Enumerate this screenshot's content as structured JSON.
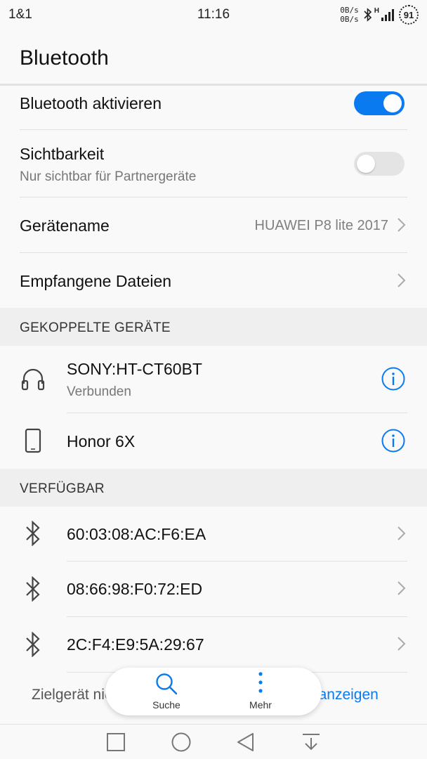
{
  "status_bar": {
    "carrier": "1&1",
    "time": "11:16",
    "net_up": "0B/s",
    "net_down": "0B/s",
    "network_type": "H",
    "battery": "91"
  },
  "header": {
    "title": "Bluetooth"
  },
  "settings": {
    "bluetooth_toggle": {
      "label": "Bluetooth aktivieren",
      "enabled": true
    },
    "visibility": {
      "label": "Sichtbarkeit",
      "sub": "Nur sichtbar für Partnergeräte",
      "enabled": false
    },
    "device_name": {
      "label": "Gerätename",
      "value": "HUAWEI P8 lite 2017"
    },
    "received_files": {
      "label": "Empfangene Dateien"
    }
  },
  "paired": {
    "title": "GEKOPPELTE GERÄTE",
    "devices": [
      {
        "name": "SONY:HT-CT60BT",
        "status": "Verbunden",
        "icon": "headphones-icon"
      },
      {
        "name": "Honor 6X",
        "status": "",
        "icon": "phone-icon"
      }
    ]
  },
  "available": {
    "title": "VERFÜGBAR",
    "devices": [
      {
        "name": "60:03:08:AC:F6:EA",
        "icon": "bluetooth-icon"
      },
      {
        "name": "08:66:98:F0:72:ED",
        "icon": "bluetooth-icon"
      },
      {
        "name": "2C:F4:E9:5A:29:67",
        "icon": "bluetooth-icon"
      }
    ]
  },
  "footer": {
    "text": "Zielgerät nicht gefunden? Mögliche Gründe ",
    "link": "anzeigen"
  },
  "fab": {
    "search_label": "Suche",
    "more_label": "Mehr"
  },
  "colors": {
    "accent": "#0a7af0",
    "section_bg": "#efefef",
    "background": "#f9f9f9"
  }
}
